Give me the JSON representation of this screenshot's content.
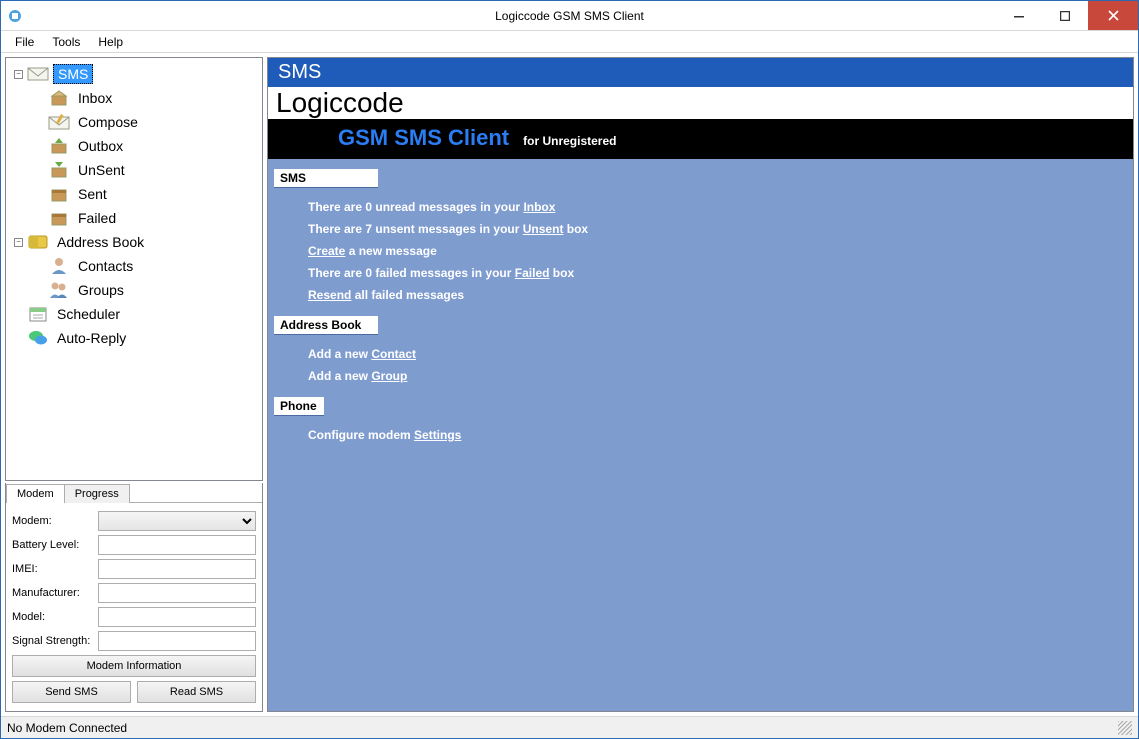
{
  "window": {
    "title": "Logiccode GSM SMS Client"
  },
  "menu": {
    "file": "File",
    "tools": "Tools",
    "help": "Help"
  },
  "tree": {
    "sms": {
      "label": "SMS",
      "inbox": "Inbox",
      "compose": "Compose",
      "outbox": "Outbox",
      "unsent": "UnSent",
      "sent": "Sent",
      "failed": "Failed"
    },
    "addressbook": {
      "label": "Address Book",
      "contacts": "Contacts",
      "groups": "Groups"
    },
    "scheduler": "Scheduler",
    "autoreply": "Auto-Reply"
  },
  "tabs": {
    "modem": "Modem",
    "progress": "Progress"
  },
  "modemForm": {
    "modemLabel": "Modem:",
    "batteryLabel": "Battery Level:",
    "imeiLabel": "IMEI:",
    "manufacturerLabel": "Manufacturer:",
    "modelLabel": "Model:",
    "signalLabel": "Signal Strength:",
    "infoBtn": "Modem Information",
    "sendBtn": "Send SMS",
    "readBtn": "Read SMS",
    "modemValue": "",
    "batteryValue": "",
    "imeiValue": "",
    "manufacturerValue": "",
    "modelValue": "",
    "signalValue": ""
  },
  "panel": {
    "header": "SMS",
    "brand": "Logiccode",
    "product": "GSM SMS Client",
    "registration": "for Unregistered",
    "sections": {
      "sms": {
        "title": "SMS",
        "line1a": "There are 0 unread messages in your ",
        "line1link": "Inbox",
        "line2a": "There are 7 unsent messages in your ",
        "line2link": "Unsent",
        "line2b": " box",
        "line3link": "Create",
        "line3b": " a new message",
        "line4a": "There are 0 failed messages in your ",
        "line4link": "Failed",
        "line4b": " box",
        "line5link": "Resend",
        "line5b": " all failed messages"
      },
      "ab": {
        "title": "Address Book",
        "line1a": "Add a new ",
        "line1link": "Contact",
        "line2a": "Add a new ",
        "line2link": "Group"
      },
      "phone": {
        "title": "Phone",
        "line1a": "Configure modem ",
        "line1link": "Settings"
      }
    }
  },
  "status": {
    "text": "No Modem Connected"
  }
}
